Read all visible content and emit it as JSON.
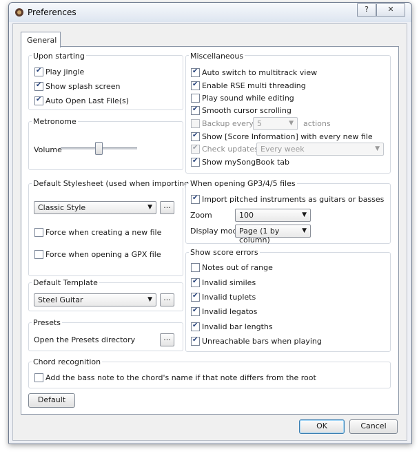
{
  "window": {
    "title": "Preferences",
    "help_label": "?",
    "close_label": "✕"
  },
  "tabs": [
    {
      "label": "General"
    }
  ],
  "upon_starting": {
    "legend": "Upon starting",
    "items": [
      {
        "label": "Play jingle",
        "checked": true
      },
      {
        "label": "Show splash screen",
        "checked": true
      },
      {
        "label": "Auto Open Last File(s)",
        "checked": true
      }
    ]
  },
  "metronome": {
    "legend": "Metronome",
    "volume_label": "Volume",
    "volume_level": 0.5
  },
  "stylesheet": {
    "legend": "Default Stylesheet (used when importing files)",
    "selected": "Classic Style",
    "browse_label": "...",
    "force_new_label": "Force when creating a new file",
    "force_gpx_label": "Force when opening a GPX file"
  },
  "template": {
    "legend": "Default Template",
    "selected": "Steel Guitar",
    "browse_label": "..."
  },
  "presets": {
    "legend": "Presets",
    "label": "Open the Presets directory",
    "browse_label": "..."
  },
  "misc": {
    "legend": "Miscellaneous",
    "items": [
      {
        "label": "Auto switch to multitrack view",
        "checked": true
      },
      {
        "label": "Enable RSE multi threading",
        "checked": true
      },
      {
        "label": "Play sound while editing",
        "checked": false
      },
      {
        "label": "Smooth cursor scrolling",
        "checked": true
      },
      {
        "label": "Backup every",
        "checked": false
      },
      {
        "label": "Show [Score Information] with every new file",
        "checked": true
      },
      {
        "label": "Check updates",
        "checked": true
      },
      {
        "label": "Show mySongBook tab",
        "checked": true
      }
    ],
    "backup_value": "5",
    "backup_unit": "actions",
    "update_frequency": "Every week"
  },
  "gp_import": {
    "legend": "When opening GP3/4/5 files",
    "import_label": "Import pitched instruments as guitars or basses",
    "zoom_label": "Zoom",
    "zoom_value": "100",
    "display_label": "Display mode",
    "display_value": "Page (1 by column)"
  },
  "score_errors": {
    "legend": "Show score errors",
    "items": [
      {
        "label": "Notes out of range",
        "checked": false
      },
      {
        "label": "Invalid similes",
        "checked": true
      },
      {
        "label": "Invalid tuplets",
        "checked": true
      },
      {
        "label": "Invalid legatos",
        "checked": true
      },
      {
        "label": "Invalid bar lengths",
        "checked": true
      },
      {
        "label": "Unreachable bars when playing",
        "checked": true
      }
    ]
  },
  "chord": {
    "legend": "Chord recognition",
    "label": "Add the bass note to the chord's name if that note differs from the root"
  },
  "buttons": {
    "default": "Default",
    "ok": "OK",
    "cancel": "Cancel"
  }
}
